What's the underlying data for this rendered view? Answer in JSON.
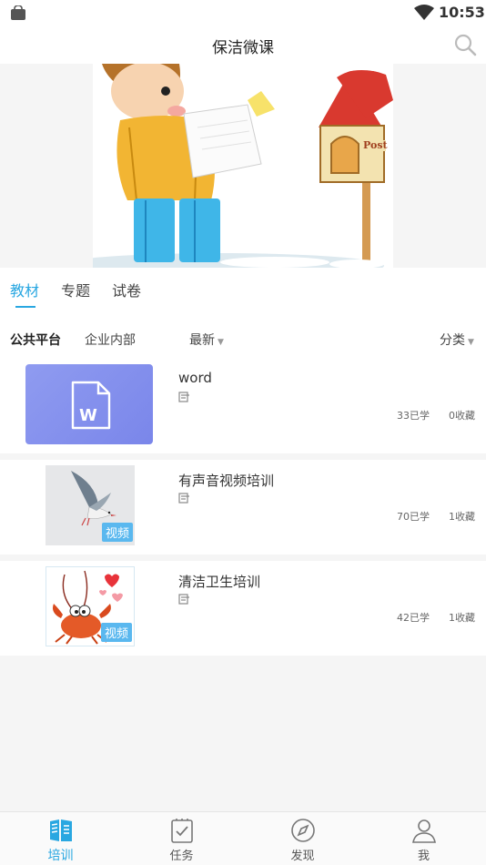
{
  "status_bar": {
    "time": "10:53"
  },
  "header": {
    "title": "保洁微课"
  },
  "tabs": [
    {
      "label": "教材",
      "active": true
    },
    {
      "label": "专题",
      "active": false
    },
    {
      "label": "试卷",
      "active": false
    }
  ],
  "filters": {
    "public_platform": "公共平台",
    "enterprise_internal": "企业内部",
    "sort": "最新",
    "category": "分类"
  },
  "courses": [
    {
      "title": "word",
      "learned": "33已学",
      "favorites": "0收藏",
      "thumbnail": "word-document-icon",
      "badge": ""
    },
    {
      "title": "有声音视频培训",
      "learned": "70已学",
      "favorites": "1收藏",
      "thumbnail": "seagull-image",
      "badge": "视频"
    },
    {
      "title": "清洁卫生培训",
      "learned": "42已学",
      "favorites": "1收藏",
      "thumbnail": "cartoon-crab-image",
      "badge": "视频"
    }
  ],
  "bottom_nav": [
    {
      "label": "培训",
      "icon": "book-icon",
      "active": true
    },
    {
      "label": "任务",
      "icon": "clipboard-check-icon",
      "active": false
    },
    {
      "label": "发现",
      "icon": "compass-icon",
      "active": false
    },
    {
      "label": "我",
      "icon": "person-icon",
      "active": false
    }
  ],
  "colors": {
    "accent": "#29a7e1",
    "badge": "#5ab8ef",
    "word_thumb": "#8a95ee"
  }
}
